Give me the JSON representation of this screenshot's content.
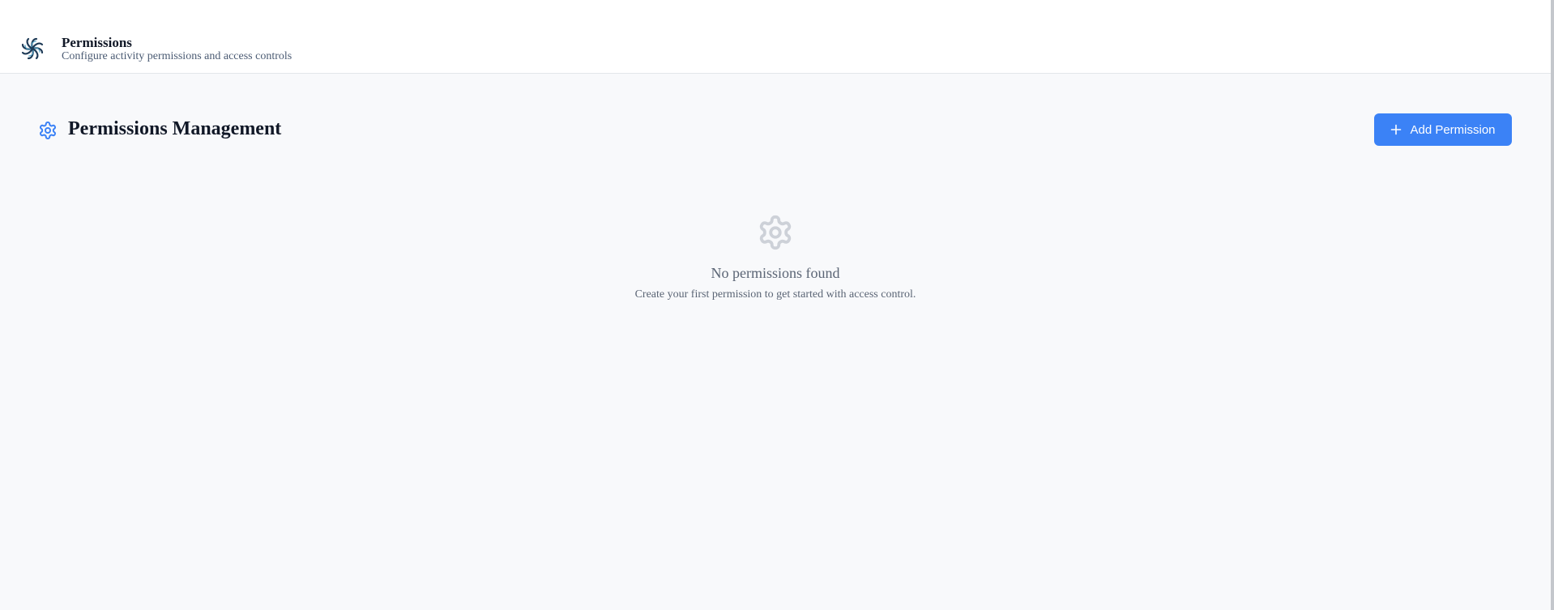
{
  "header": {
    "title": "Permissions",
    "subtitle": "Configure activity permissions and access controls",
    "logo_icon": "pinwheel-logo-icon"
  },
  "section": {
    "icon": "gear-icon",
    "title": "Permissions Management",
    "add_button_label": "Add Permission",
    "add_button_icon": "plus-icon"
  },
  "empty_state": {
    "icon": "gear-icon",
    "title": "No permissions found",
    "description": "Create your first permission to get started with access control."
  },
  "colors": {
    "accent": "#3b82f6",
    "background": "#f8f9fb",
    "header_bg": "#ffffff",
    "muted_text": "#5b6575",
    "heading_text": "#111827"
  }
}
